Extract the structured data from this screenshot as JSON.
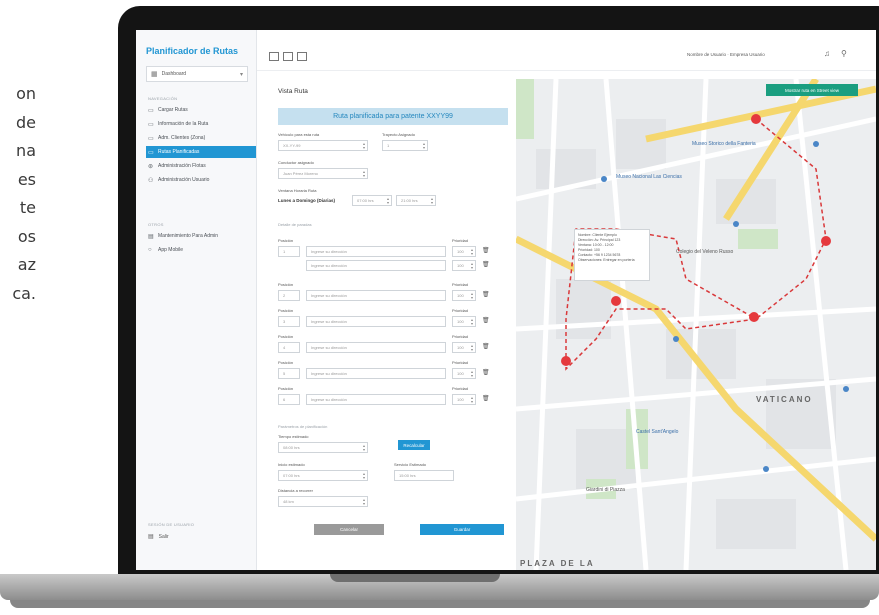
{
  "side_text": [
    "on",
    "de",
    "na",
    "es",
    "te",
    "os",
    "az",
    "ca."
  ],
  "sidebar": {
    "brand": "Planificador de Rutas",
    "dashboard": "Dashboard",
    "section_main": "NAVEGACIÓN",
    "items": [
      {
        "label": "Cargar Rutas",
        "icon": "upload-icon"
      },
      {
        "label": "Información de la Ruta",
        "icon": "info-icon"
      },
      {
        "label": "Adm. Clientes (Zona)",
        "icon": "clients-icon"
      },
      {
        "label": "Rutas Planificadas",
        "icon": "route-icon",
        "active": true
      },
      {
        "label": "Administración Flotas",
        "icon": "fleet-icon"
      },
      {
        "label": "Administración Usuario",
        "icon": "user-icon"
      }
    ],
    "section_other": "OTROS",
    "other_items": [
      {
        "label": "Mantenimiento Para Admin",
        "icon": "maintenance-icon"
      },
      {
        "label": "App Mobile",
        "icon": "mobile-icon"
      }
    ],
    "section_session": "SESIÓN DE USUARIO",
    "exit": "Salir"
  },
  "topbar": {
    "user": "Nombre de Usuario · Empresa Usuario"
  },
  "form": {
    "title": "Vista Ruta",
    "banner": "Ruta planificada para patente XXYY99",
    "vehicle_label": "Vehículo para esta ruta",
    "vehicle_value": "XX-YY-99",
    "trips_label": "Trayecto Asignado",
    "trips_value": "1",
    "driver_label": "Conductor asignado",
    "driver_value": "Juan Pérez Moreno",
    "window_label": "Ventana Horaria Ruta",
    "window_day": "Lunes a Domingo (Diarias)",
    "window_from": "07:00 hrs",
    "window_to": "21:00 hrs",
    "stops_section": "Detalle de paradas",
    "pos_label": "Posición",
    "prio_label": "Prioridad",
    "address_placeholder": "Ingrese su dirección",
    "stops": [
      {
        "pos": "1",
        "prio": "100"
      },
      {
        "pos": "2",
        "prio": "100"
      },
      {
        "pos": "3",
        "prio": "100"
      },
      {
        "pos": "4",
        "prio": "100"
      },
      {
        "pos": "5",
        "prio": "100"
      },
      {
        "pos": "6",
        "prio": "100"
      }
    ],
    "params_section": "Parámetros de planificación",
    "est_time_label": "Tiempo estimado",
    "est_time_value": "08:00 hrs",
    "recalc": "Recalcular",
    "start_label": "Inicio estimado",
    "start_value": "07:00 hrs",
    "end_label": "Servicio Estimado",
    "end_value": "15:00 hrs",
    "distance_label": "Distancia a recorrer",
    "distance_value": "48 km",
    "cancel": "Cancelar",
    "save": "Guardar"
  },
  "map": {
    "button": "Mostrar ruta en Street view",
    "labels": [
      "Museo Storico della Fanteria",
      "Museo Nacional Las Ciencias",
      "Colegio del Veleno Russo",
      "VATICANO",
      "PLAZA DE LA",
      "Castel Sant'Angelo",
      "Giardini di Piazza"
    ],
    "popup": [
      "Nombre: Cliente Ejemplo",
      "Dirección: Av. Principal 123",
      "Ventana: 10:00 - 12:00",
      "Prioridad: 100",
      "Contacto: +56 9 1234 5678",
      "Observaciones: Entregar en portería"
    ]
  }
}
